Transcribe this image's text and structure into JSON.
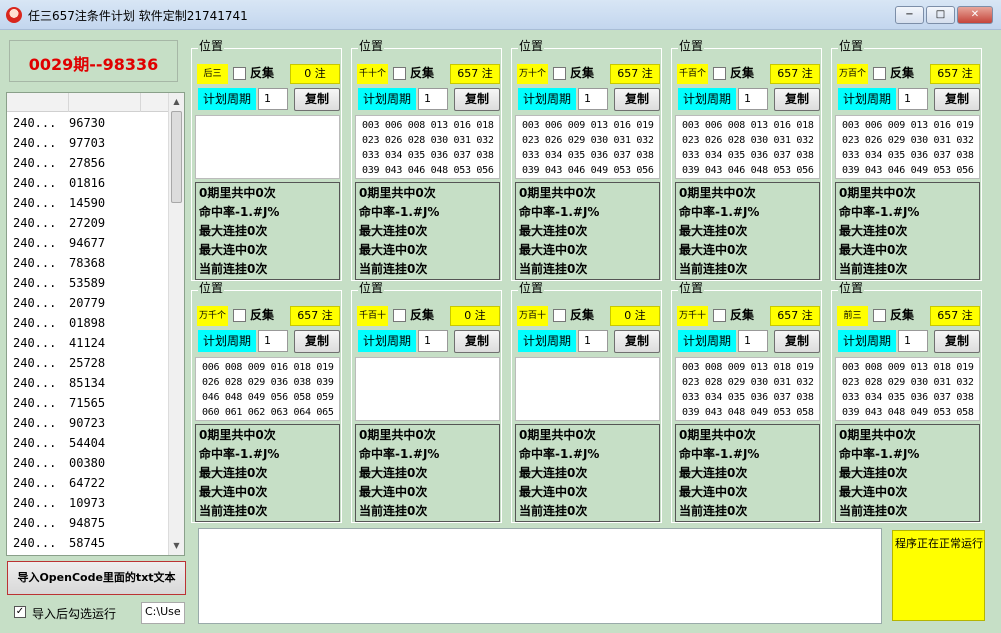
{
  "window": {
    "title": "任三657注条件计划 软件定制21741741",
    "min_glyph": "−",
    "max_glyph": "□",
    "close_glyph": "✕",
    "icon": "app-logo-icon"
  },
  "issue_display": "0029期--98336",
  "history": [
    {
      "period": "240...",
      "code": "96730"
    },
    {
      "period": "240...",
      "code": "97703"
    },
    {
      "period": "240...",
      "code": "27856"
    },
    {
      "period": "240...",
      "code": "01816"
    },
    {
      "period": "240...",
      "code": "14590"
    },
    {
      "period": "240...",
      "code": "27209"
    },
    {
      "period": "240...",
      "code": "94677"
    },
    {
      "period": "240...",
      "code": "78368"
    },
    {
      "period": "240...",
      "code": "53589"
    },
    {
      "period": "240...",
      "code": "20779"
    },
    {
      "period": "240...",
      "code": "01898"
    },
    {
      "period": "240...",
      "code": "41124"
    },
    {
      "period": "240...",
      "code": "25728"
    },
    {
      "period": "240...",
      "code": "85134"
    },
    {
      "period": "240...",
      "code": "71565"
    },
    {
      "period": "240...",
      "code": "90723"
    },
    {
      "period": "240...",
      "code": "54404"
    },
    {
      "period": "240...",
      "code": "00380"
    },
    {
      "period": "240...",
      "code": "64722"
    },
    {
      "period": "240...",
      "code": "10973"
    },
    {
      "period": "240...",
      "code": "94875"
    },
    {
      "period": "240...",
      "code": "58745"
    }
  ],
  "import_button": "导入OpenCode里面的txt文本",
  "run_after_import": {
    "label": "导入后勾选运行",
    "checked": true,
    "mark": "✓"
  },
  "path_value": "C:\\Use",
  "status_text": "程序正在正常运行",
  "panel_common": {
    "group_label": "位置",
    "invert_label": "反集",
    "cycle_label": "计划周期",
    "cycle_value": "1",
    "copy_label": "复制"
  },
  "panels": [
    {
      "position": "后三",
      "count": "0 注",
      "numbers": [],
      "stats": [
        "0期里共中0次",
        "命中率-1.#J%",
        "最大连挂0次",
        "最大连中0次",
        "当前连挂0次"
      ]
    },
    {
      "position": "千十个",
      "count": "657 注",
      "numbers": [
        "003 006 008 013 016 018",
        "023 026 028 030 031 032",
        "033 034 035 036 037 038",
        "039 043 046 048 053 056"
      ],
      "stats": [
        "0期里共中0次",
        "命中率-1.#J%",
        "最大连挂0次",
        "最大连中0次",
        "当前连挂0次"
      ]
    },
    {
      "position": "万十个",
      "count": "657 注",
      "numbers": [
        "003 006 009 013 016 019",
        "023 026 029 030 031 032",
        "033 034 035 036 037 038",
        "039 043 046 049 053 056"
      ],
      "stats": [
        "0期里共中0次",
        "命中率-1.#J%",
        "最大连挂0次",
        "最大连中0次",
        "当前连挂0次"
      ]
    },
    {
      "position": "千百个",
      "count": "657 注",
      "numbers": [
        "003 006 008 013 016 018",
        "023 026 028 030 031 032",
        "033 034 035 036 037 038",
        "039 043 046 048 053 056"
      ],
      "stats": [
        "0期里共中0次",
        "命中率-1.#J%",
        "最大连挂0次",
        "最大连中0次",
        "当前连挂0次"
      ]
    },
    {
      "position": "万百个",
      "count": "657 注",
      "numbers": [
        "003 006 009 013 016 019",
        "023 026 029 030 031 032",
        "033 034 035 036 037 038",
        "039 043 046 049 053 056"
      ],
      "stats": [
        "0期里共中0次",
        "命中率-1.#J%",
        "最大连挂0次",
        "最大连中0次",
        "当前连挂0次"
      ]
    },
    {
      "position": "万千个",
      "count": "657 注",
      "numbers": [
        "006 008 009 016 018 019",
        "026 028 029 036 038 039",
        "046 048 049 056 058 059",
        "060 061 062 063 064 065"
      ],
      "stats": [
        "0期里共中0次",
        "命中率-1.#J%",
        "最大连挂0次",
        "最大连中0次",
        "当前连挂0次"
      ]
    },
    {
      "position": "千百十",
      "count": "0 注",
      "numbers": [],
      "stats": [
        "0期里共中0次",
        "命中率-1.#J%",
        "最大连挂0次",
        "最大连中0次",
        "当前连挂0次"
      ]
    },
    {
      "position": "万百十",
      "count": "0 注",
      "numbers": [],
      "stats": [
        "0期里共中0次",
        "命中率-1.#J%",
        "最大连挂0次",
        "最大连中0次",
        "当前连挂0次"
      ]
    },
    {
      "position": "万千十",
      "count": "657 注",
      "numbers": [
        "003 008 009 013 018 019",
        "023 028 029 030 031 032",
        "033 034 035 036 037 038",
        "039 043 048 049 053 058"
      ],
      "stats": [
        "0期里共中0次",
        "命中率-1.#J%",
        "最大连挂0次",
        "最大连中0次",
        "当前连挂0次"
      ]
    },
    {
      "position": "前三",
      "count": "657 注",
      "numbers": [
        "003 008 009 013 018 019",
        "023 028 029 030 031 032",
        "033 034 035 036 037 038",
        "039 043 048 049 053 058"
      ],
      "stats": [
        "0期里共中0次",
        "命中率-1.#J%",
        "最大连挂0次",
        "最大连中0次",
        "当前连挂0次"
      ]
    }
  ]
}
